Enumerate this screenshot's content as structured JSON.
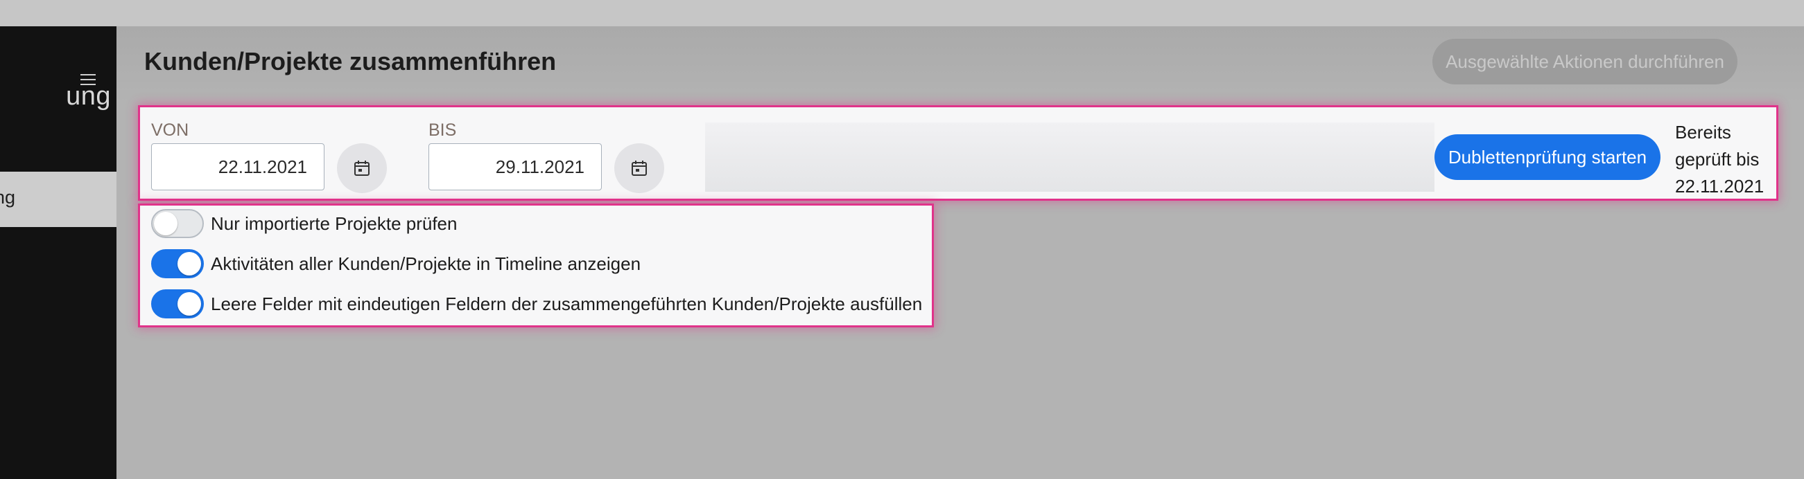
{
  "sidebar": {
    "title_fragment": "ung",
    "active_item_fragment": "ng",
    "menu_icon": "hamburger-menu-icon"
  },
  "header": {
    "title": "Kunden/Projekte zusammenführen",
    "action_button_label": "Ausgewählte Aktionen durchführen"
  },
  "date_filter": {
    "from_label": "VON",
    "from_value": "22.11.2021",
    "to_label": "BIS",
    "to_value": "29.11.2021",
    "calendar_icon": "calendar-icon",
    "start_button_label": "Dublettenprüfung starten",
    "checked_until_line1": "Bereits",
    "checked_until_line2": "geprüft bis",
    "checked_until_date": "22.11.2021"
  },
  "options": [
    {
      "label": "Nur importierte Projekte prüfen",
      "enabled": false
    },
    {
      "label": "Aktivitäten aller Kunden/Projekte in Timeline anzeigen",
      "enabled": true
    },
    {
      "label": "Leere Felder mit eindeutigen Feldern der zusammengeführten Kunden/Projekte ausfüllen",
      "enabled": true
    }
  ],
  "colors": {
    "accent": "#1a73e8",
    "highlight": "#e0338a",
    "sidebar": "#121212"
  }
}
